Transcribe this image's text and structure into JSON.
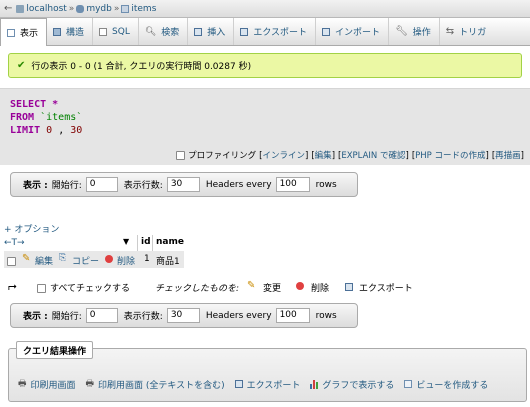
{
  "breadcrumb": {
    "server": "localhost",
    "database": "mydb",
    "table": "items",
    "sep": "»"
  },
  "tabs": [
    {
      "label": "表示",
      "icon": "browse-icon",
      "active": true
    },
    {
      "label": "構造",
      "icon": "structure-icon"
    },
    {
      "label": "SQL",
      "icon": "sql-icon"
    },
    {
      "label": "検索",
      "icon": "search-icon"
    },
    {
      "label": "挿入",
      "icon": "insert-icon"
    },
    {
      "label": "エクスポート",
      "icon": "export-icon"
    },
    {
      "label": "インポート",
      "icon": "import-icon"
    },
    {
      "label": "操作",
      "icon": "wrench-icon"
    },
    {
      "label": "トリガ",
      "icon": "trigger-icon"
    }
  ],
  "message": "行の表示 0 - 0 (1 合計, クエリの実行時間 0.0287 秒)",
  "sql": {
    "select": "SELECT",
    "star": "*",
    "from": "FROM",
    "table": "`items`",
    "limit": "LIMIT",
    "offset": "0",
    "comma": ",",
    "count": "30"
  },
  "sql_links": {
    "profiling": "プロファイリング",
    "inline": "インライン",
    "edit": "編集",
    "explain": "EXPLAIN で確認",
    "php": "PHP コードの作成",
    "refresh": "再描画"
  },
  "nav": {
    "show_label": "表示 :",
    "start_label": "開始行:",
    "start_value": "0",
    "rows_label": "表示行数:",
    "rows_value": "30",
    "headers_label": "Headers every",
    "headers_value": "100",
    "rows_suffix": "rows"
  },
  "options_link": "+ オプション",
  "table": {
    "sort_arrows": "←T→",
    "columns": [
      "id",
      "name"
    ],
    "rows": [
      {
        "edit": "編集",
        "copy": "コピー",
        "delete": "削除",
        "id": "1",
        "name": "商品1"
      }
    ]
  },
  "bulk": {
    "check_all": "すべてチェックする",
    "with_selected": "チェックしたものを:",
    "change": "変更",
    "delete": "削除",
    "export": "エクスポート"
  },
  "query_ops": {
    "legend": "クエリ結果操作",
    "print": "印刷用画面",
    "print_full": "印刷用画面 (全テキストを含む)",
    "export": "エクスポート",
    "chart": "グラフで表示する",
    "view": "ビューを作成する"
  }
}
